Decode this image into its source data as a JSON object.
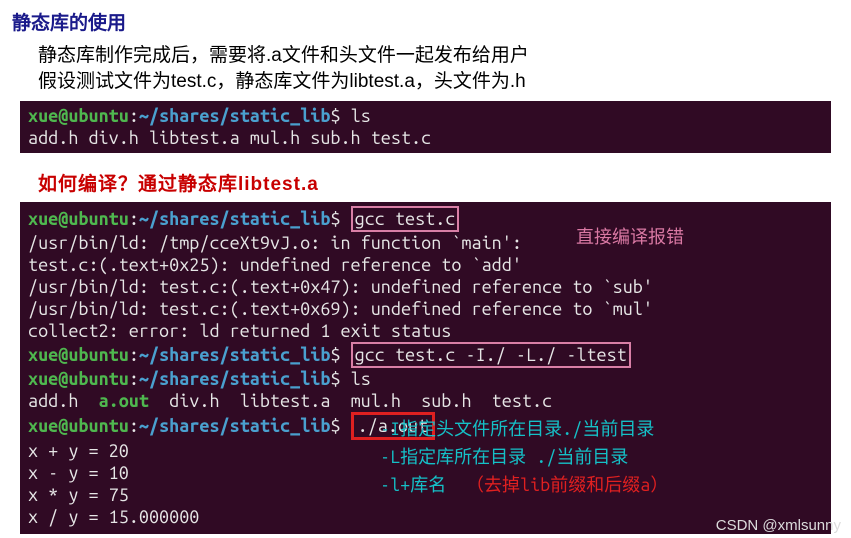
{
  "heading": "静态库的使用",
  "intro": {
    "line1": "静态库制作完成后，需要将.a文件和头文件一起发布给用户",
    "line2": "假设测试文件为test.c，静态库文件为libtest.a，头文件为.h"
  },
  "term1": {
    "prompt": {
      "user": "xue",
      "at": "@",
      "host": "ubuntu",
      "colon": ":",
      "path": "~/shares/static_lib",
      "dollar": "$"
    },
    "cmd": "ls",
    "out": "add.h  div.h  libtest.a  mul.h  sub.h  test.c"
  },
  "callout": "如何编译？通过静态库libtest.a",
  "term2": {
    "prompt": {
      "user": "xue",
      "at": "@",
      "host": "ubuntu",
      "colon": ":",
      "path": "~/shares/static_lib",
      "dollar": "$"
    },
    "lines": {
      "gcc1_cmd": "gcc test.c",
      "err1": "/usr/bin/ld: /tmp/cceXt9vJ.o: in function `main':",
      "err2": "test.c:(.text+0x25): undefined reference to `add'",
      "err3": "/usr/bin/ld: test.c:(.text+0x47): undefined reference to `sub'",
      "err4": "/usr/bin/ld: test.c:(.text+0x69): undefined reference to `mul'",
      "err5": "collect2: error: ld returned 1 exit status",
      "gcc2_cmd": "gcc test.c -I./ -L./ -ltest",
      "ls_cmd": "ls",
      "ls_out": "add.h  a.out  div.h  libtest.a  mul.h  sub.h  test.c",
      "run_cmd": "./a.out",
      "r1": "x + y = 20",
      "r2": "x - y = 10",
      "r3": "x * y = 75",
      "r4": "x / y = 15.000000"
    }
  },
  "annot": {
    "direct_compile_error": "直接编译报错",
    "I_note": "-I指定头文件所在目录./当前目录",
    "L_note": "-L指定库所在目录 ./当前目录",
    "l_note": "-l+库名",
    "l_note_paren": "（去掉lib前缀和后缀a）"
  },
  "watermark": "CSDN @xmlsunny"
}
